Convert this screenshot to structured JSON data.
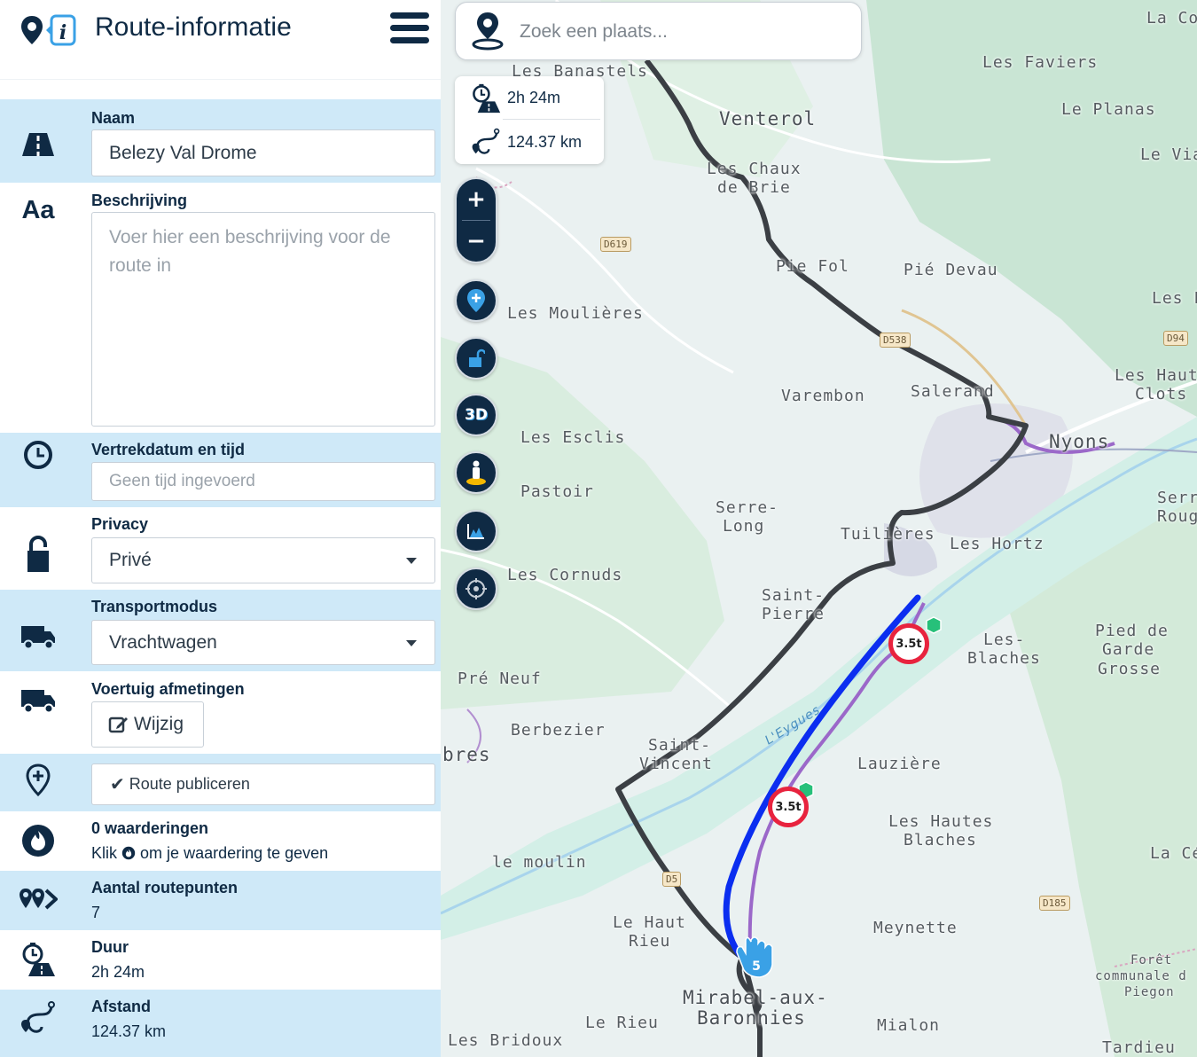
{
  "header": {
    "title": "Route-informatie"
  },
  "fields": {
    "naam": {
      "label": "Naam",
      "value": "Belezy Val Drome"
    },
    "beschrijving": {
      "label": "Beschrijving",
      "placeholder": "Voer hier een beschrijving voor de route in"
    },
    "vertrek": {
      "label": "Vertrekdatum en tijd",
      "placeholder": "Geen tijd ingevoerd"
    },
    "privacy": {
      "label": "Privacy",
      "value": "Privé"
    },
    "transport": {
      "label": "Transportmodus",
      "value": "Vrachtwagen"
    },
    "voertuig": {
      "label": "Voertuig afmetingen",
      "button": "Wijzig"
    },
    "publiceren": {
      "button": "Route publiceren"
    },
    "waardering": {
      "label": "0 waarderingen",
      "hint_before": "Klik",
      "hint_after": "om je waardering te geven"
    },
    "routepunten": {
      "label": "Aantal routepunten",
      "value": "7"
    },
    "duur": {
      "label": "Duur",
      "value": "2h 24m"
    },
    "afstand": {
      "label": "Afstand",
      "value": "124.37 km"
    }
  },
  "map": {
    "search_placeholder": "Zoek een plaats...",
    "stats": {
      "duration": "2h 24m",
      "distance": "124.37 km"
    },
    "zoom_in": "+",
    "zoom_out": "−",
    "btn_3d": "3D",
    "waypoint_number": "5",
    "weight_limit": "3.5t",
    "rivers": [
      "L'Eygues"
    ],
    "roads": [
      "D619",
      "D538",
      "D94",
      "D185",
      "D5"
    ],
    "places": [
      "La Co",
      "Les Banastels",
      "Les Faviers",
      "Le Planas",
      "Venterol",
      "Le Vial",
      "Les Chaux",
      "de Brie",
      "Pie Fol",
      "Pié Devau",
      "Les Fo",
      "Les Moulières",
      "Les Hauts",
      "Clots",
      "Varembon",
      "Salerand",
      "Nyons",
      "Les Esclis",
      "Pastoir",
      "Serre-",
      "Long",
      "Tuilières",
      "Les Hortz",
      "Serr",
      "Roug",
      "Les Cornuds",
      "Saint-",
      "Pierre",
      "Les-",
      "Blaches",
      "Pied de",
      "Garde",
      "Grosse",
      "Pré Neuf",
      "Berbezier",
      "bres",
      "Saint-",
      "Vincent",
      "Lauzière",
      "Les Hautes",
      "Blaches",
      "le moulin",
      "La Cé",
      "Le Haut",
      "Rieu",
      "Meynette",
      "Mirabel-aux-",
      "Baronnies",
      "Forêt",
      "communale d",
      "Piegon",
      "Le Rieu",
      "Mialon",
      "Les Bridoux",
      "Tardieu"
    ]
  },
  "colors": {
    "accent": "#0f2a44",
    "panel_blue": "#cfe9f8",
    "route_blue": "#0b2ef0",
    "route_dark": "#3b3f44",
    "restriction": "#e8233e"
  }
}
